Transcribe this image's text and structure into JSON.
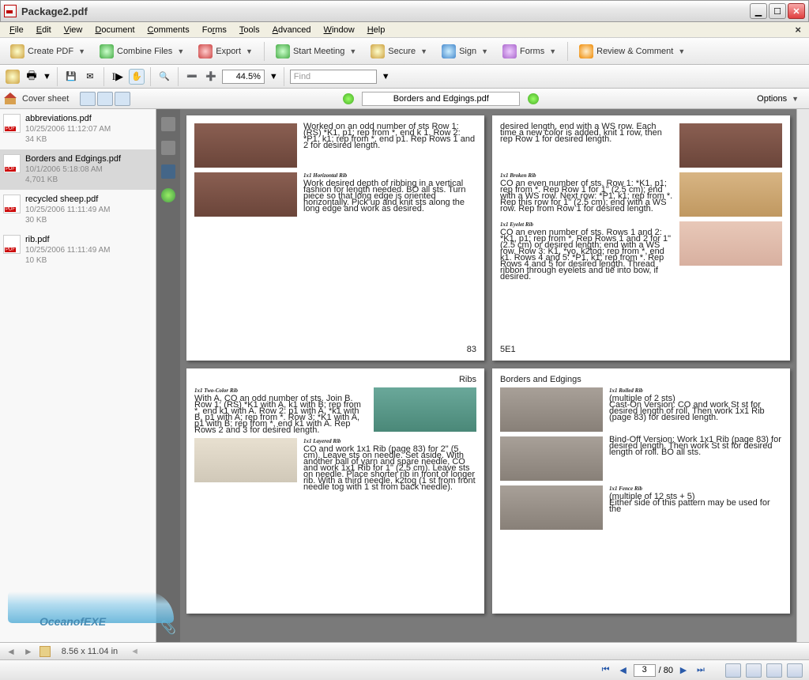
{
  "window": {
    "title": "Package2.pdf"
  },
  "menus": [
    "File",
    "Edit",
    "View",
    "Document",
    "Comments",
    "Forms",
    "Tools",
    "Advanced",
    "Window",
    "Help"
  ],
  "toolbar1": {
    "create": "Create PDF",
    "combine": "Combine Files",
    "export": "Export",
    "meeting": "Start Meeting",
    "secure": "Secure",
    "sign": "Sign",
    "forms": "Forms",
    "review": "Review & Comment"
  },
  "toolbar2": {
    "zoom": "44.5%",
    "find_placeholder": "Find"
  },
  "nav": {
    "cover": "Cover sheet",
    "docname": "Borders and Edgings.pdf",
    "options": "Options"
  },
  "files": [
    {
      "name": "abbreviations.pdf",
      "date": "10/25/2006 11:12:07 AM",
      "size": "34 KB",
      "selected": false
    },
    {
      "name": "Borders and Edgings.pdf",
      "date": "10/1/2006 5:18:08 AM",
      "size": "4,701 KB",
      "selected": true
    },
    {
      "name": "recycled sheep.pdf",
      "date": "10/25/2006 11:11:49 AM",
      "size": "30 KB",
      "selected": false
    },
    {
      "name": "rib.pdf",
      "date": "10/25/2006 11:11:49 AM",
      "size": "10 KB",
      "selected": false
    }
  ],
  "pages": {
    "p1": {
      "s1": {
        "body": "Worked on an odd number of sts\nRow 1: (RS) *K1, p1; rep from *, end k 1.\nRow 2: *P1, k1; rep from *, end p1.\nRep Rows 1 and 2 for desired length."
      },
      "s2": {
        "title": "1x1  Horizontal  Rib",
        "body": "Work desired depth of ribbing in a vertical fashion for length needed. BO all sts. Turn piece so that long edge is oriented horizontally. Pick up and knit sts along the long edge and work as desired."
      },
      "pageno": "83"
    },
    "p2": {
      "s1": {
        "body": "desired length, end with a WS row. Each time a new color is added, knit 1 row, then rep Row 1 for desired length."
      },
      "s2": {
        "title": "1x1  Broken  Rib",
        "body": "CO an even number of sts.\nRow 1: *K1, p1; rep from *.\nRep Row 1 for 1\" (2.5 cm); end with a WS row.\nNext row: *P1, k1; rep from *.\nRep this row for 1\" (2.5 cm); end with a WS row.\nRep from Row 1 for desired length."
      },
      "s3": {
        "title": "1x1  Eyelet  Rib",
        "body": "CO an even number of sts.\nRows 1 and 2: *K1, p1; rep from *.\nRep Rows 1 and 2 for 1\" (2.5 cm) or desired length; end with a WS row.\nRow 3: K1, *yo, k2tog; rep from *, end k1.\nRows 4 and 5: *P1, k1; rep from *.\nRep Rows 4 and 5 for desired length. Thread ribbon through eyelets and tie into bow, if desired."
      },
      "pageno": "5E1"
    },
    "p3": {
      "label": "Ribs",
      "s1": {
        "title": "1x1  Two-Color  Rib",
        "body": "With A, CO an odd number of sts. Join B.\nRow 1: (RS) *K1 with A, k1 with B; rep from *, end k1 with A.\nRow 2: p1 with A, *k1 with B, p1 with A; rep from *.\nRow 3: *K1 with A, p1 with B; rep from *, end k1 with A.\nRep Rows 2 and 3 for desired length."
      },
      "s2": {
        "title": "1x1  Layered  Rib",
        "body": "CO and work 1x1 Rib (page 83) for 2\" (5 cm). Leave sts on needle. Set aside. With another ball of yarn and spare needle, CO and work 1x1 Rib for 1\" (2.5 cm). Leave sts on needle. Place shorter rib in front of longer rib. With a third needle, k2tog (1 st from front needle tog with 1 st from back needle)."
      }
    },
    "p4": {
      "label": "Borders and Edgings",
      "s1": {
        "title": "1x1  Rolled  Rib",
        "sub": "(multiple of 2 sts)",
        "body": "Cast-On Version: CO and work St st for desired length of roll. Then work 1x1 Rib (page 83) for desired length.",
        "body2": "Bind-Off Version: Work 1x1 Rib (page 83) for desired length. Then work St st for desired length of roll. BO all sts."
      },
      "s2": {
        "title": "1x1  Fence  Rib",
        "sub": "(multiple of 12 sts + 5)",
        "body": "Either side of this pattern may be used for the"
      }
    }
  },
  "status": {
    "dims": "8.56 x 11.04 in"
  },
  "bottom": {
    "page": "3",
    "total": "80"
  },
  "watermark": "OceanofEXE"
}
